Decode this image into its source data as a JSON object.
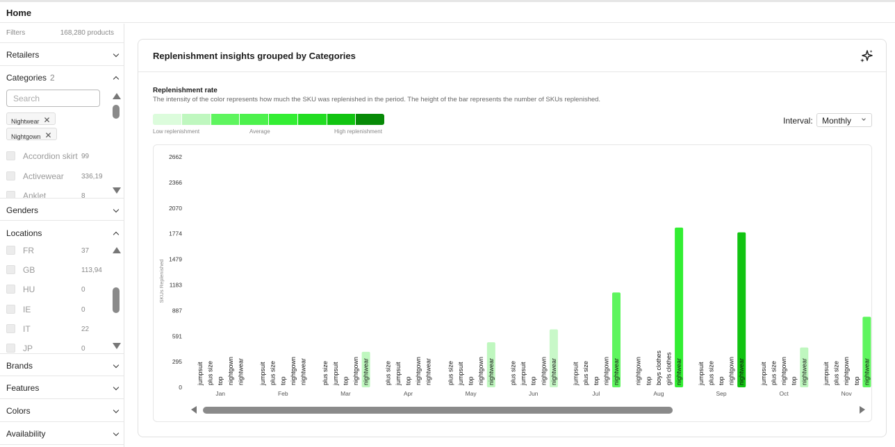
{
  "header": {
    "title": "Home"
  },
  "sidebar": {
    "filters_label": "Filters",
    "products_count": "168,280 products",
    "sections": [
      {
        "label": "Retailers",
        "expanded": false
      },
      {
        "label": "Categories",
        "count": "2",
        "expanded": true
      },
      {
        "label": "Genders",
        "expanded": false
      },
      {
        "label": "Locations",
        "expanded": true
      },
      {
        "label": "Brands",
        "expanded": false
      },
      {
        "label": "Features",
        "expanded": false
      },
      {
        "label": "Colors",
        "expanded": false
      },
      {
        "label": "Availability",
        "expanded": false
      }
    ],
    "search_placeholder": "Search",
    "chips": [
      "Nightwear",
      "Nightgown"
    ],
    "categories_options": [
      {
        "name": "Accordion skirt",
        "count": "99"
      },
      {
        "name": "Activewear",
        "count": "336,19"
      },
      {
        "name": "Anklet",
        "count": "8"
      }
    ],
    "locations_options": [
      {
        "name": "FR",
        "count": "37"
      },
      {
        "name": "GB",
        "count": "113,94"
      },
      {
        "name": "HU",
        "count": "0"
      },
      {
        "name": "IE",
        "count": "0"
      },
      {
        "name": "IT",
        "count": "22"
      },
      {
        "name": "JP",
        "count": "0"
      }
    ]
  },
  "card": {
    "title": "Replenishment insights grouped by Categories",
    "icon": "sparkle-icon",
    "rate_title": "Replenishment rate",
    "rate_desc": "The intensity of the color represents how much the SKU was replenished in the period. The height of the bar represents the number of SKUs replenished.",
    "legend_colors": [
      "#dcfcdc",
      "#bff7bf",
      "#5ef55e",
      "#4cf14c",
      "#33ee33",
      "#22dd22",
      "#11c411",
      "#078a07"
    ],
    "legend_low": "Low replenishment",
    "legend_avg": "Average",
    "legend_high": "High replenishment",
    "interval_label": "Interval:",
    "interval_value": "Monthly"
  },
  "chart_data": {
    "type": "bar",
    "ylabel": "SKUs Replenished",
    "yticks": [
      0,
      295,
      591,
      887,
      1183,
      1479,
      1774,
      2070,
      2366,
      2662
    ],
    "ylim": [
      0,
      2662
    ],
    "groups": [
      {
        "month": "Jan",
        "bars": [
          {
            "category": "jumpsuit",
            "value": 0
          },
          {
            "category": "plus size",
            "value": 0
          },
          {
            "category": "top",
            "value": 0
          },
          {
            "category": "nightgown",
            "value": 0
          },
          {
            "category": "nightwear",
            "value": 0
          }
        ]
      },
      {
        "month": "Feb",
        "bars": [
          {
            "category": "jumpsuit",
            "value": 0
          },
          {
            "category": "plus size",
            "value": 0
          },
          {
            "category": "top",
            "value": 0
          },
          {
            "category": "nightgown",
            "value": 0
          },
          {
            "category": "nightwear",
            "value": 0
          }
        ]
      },
      {
        "month": "Mar",
        "bars": [
          {
            "category": "plus size",
            "value": 0
          },
          {
            "category": "jumpsuit",
            "value": 0
          },
          {
            "category": "top",
            "value": 0
          },
          {
            "category": "nightgown",
            "value": 0
          },
          {
            "category": "nightwear",
            "value": 410,
            "color": "#bff7bf"
          }
        ]
      },
      {
        "month": "Apr",
        "bars": [
          {
            "category": "plus size",
            "value": 0
          },
          {
            "category": "jumpsuit",
            "value": 0
          },
          {
            "category": "top",
            "value": 0
          },
          {
            "category": "nightgown",
            "value": 0
          },
          {
            "category": "nightwear",
            "value": 0
          }
        ]
      },
      {
        "month": "May",
        "bars": [
          {
            "category": "plus size",
            "value": 0
          },
          {
            "category": "jumpsuit",
            "value": 0
          },
          {
            "category": "top",
            "value": 0
          },
          {
            "category": "nightgown",
            "value": 0
          },
          {
            "category": "nightwear",
            "value": 520,
            "color": "#bff7bf"
          }
        ]
      },
      {
        "month": "Jun",
        "bars": [
          {
            "category": "plus size",
            "value": 0
          },
          {
            "category": "jumpsuit",
            "value": 0
          },
          {
            "category": "top",
            "value": 0
          },
          {
            "category": "nightgown",
            "value": 0
          },
          {
            "category": "nightwear",
            "value": 670,
            "color": "#c8f8c8"
          }
        ]
      },
      {
        "month": "Jul",
        "bars": [
          {
            "category": "jumpsuit",
            "value": 0
          },
          {
            "category": "plus size",
            "value": 0
          },
          {
            "category": "top",
            "value": 0
          },
          {
            "category": "nightgown",
            "value": 0
          },
          {
            "category": "nightwear",
            "value": 1095,
            "color": "#5ef55e"
          }
        ]
      },
      {
        "month": "Aug",
        "bars": [
          {
            "category": "nightgown",
            "value": 0
          },
          {
            "category": "top",
            "value": 0
          },
          {
            "category": "boys clothes",
            "value": 0
          },
          {
            "category": "girls clothes",
            "value": 0
          },
          {
            "category": "nightwear",
            "value": 1845,
            "color": "#33ee33"
          }
        ]
      },
      {
        "month": "Sep",
        "bars": [
          {
            "category": "jumpsuit",
            "value": 0
          },
          {
            "category": "plus size",
            "value": 0
          },
          {
            "category": "top",
            "value": 0
          },
          {
            "category": "nightgown",
            "value": 0
          },
          {
            "category": "nightwear",
            "value": 1790,
            "color": "#11c411"
          }
        ]
      },
      {
        "month": "Oct",
        "bars": [
          {
            "category": "jumpsuit",
            "value": 0
          },
          {
            "category": "plus size",
            "value": 0
          },
          {
            "category": "nightgown",
            "value": 0
          },
          {
            "category": "top",
            "value": 0
          },
          {
            "category": "nightwear",
            "value": 460,
            "color": "#bff7bf"
          }
        ]
      },
      {
        "month": "Nov",
        "bars": [
          {
            "category": "jumpsuit",
            "value": 0
          },
          {
            "category": "plus size",
            "value": 0
          },
          {
            "category": "nightgown",
            "value": 0
          },
          {
            "category": "top",
            "value": 0
          },
          {
            "category": "nightwear",
            "value": 815,
            "color": "#5ef55e"
          }
        ]
      }
    ],
    "horizontal_scroll": {
      "position": 0,
      "visible_fraction": 0.72
    }
  }
}
